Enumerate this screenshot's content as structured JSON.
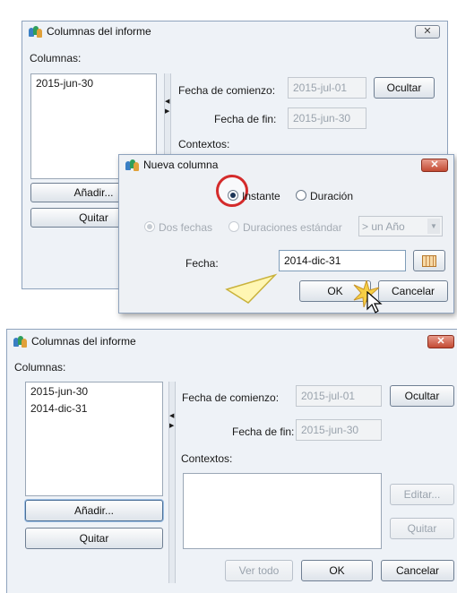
{
  "top_dialog": {
    "title": "Columnas del informe",
    "close_label": "✕",
    "columns_label": "Columnas:",
    "columns": [
      "2015-jun-30"
    ],
    "start_label": "Fecha de comienzo:",
    "start_value": "2015-jul-01",
    "end_label": "Fecha de fin:",
    "end_value": "2015-jun-30",
    "hide_label": "Ocultar",
    "contexts_label": "Contextos:",
    "add_label": "Añadir...",
    "remove_label": "Quitar"
  },
  "new_column": {
    "title": "Nueva columna",
    "close_label": "✕",
    "instant_label": "Instante",
    "duration_label": "Duración",
    "two_dates_label": "Dos fechas",
    "standard_label": "Duraciones estándar",
    "period_value": "> un Año",
    "date_label": "Fecha:",
    "date_value": "2014-dic-31",
    "ok_label": "OK",
    "cancel_label": "Cancelar"
  },
  "bottom_dialog": {
    "title": "Columnas del informe",
    "close_label": "✕",
    "columns_label": "Columnas:",
    "columns": [
      "2015-jun-30",
      "2014-dic-31"
    ],
    "start_label": "Fecha de comienzo:",
    "start_value": "2015-jul-01",
    "end_label": "Fecha de fin:",
    "end_value": "2015-jun-30",
    "hide_label": "Ocultar",
    "contexts_label": "Contextos:",
    "edit_label": "Editar...",
    "remove_ctx_label": "Quitar",
    "add_label": "Añadir...",
    "remove_label": "Quitar",
    "see_all_label": "Ver todo",
    "ok_label": "OK",
    "cancel_label": "Cancelar"
  }
}
